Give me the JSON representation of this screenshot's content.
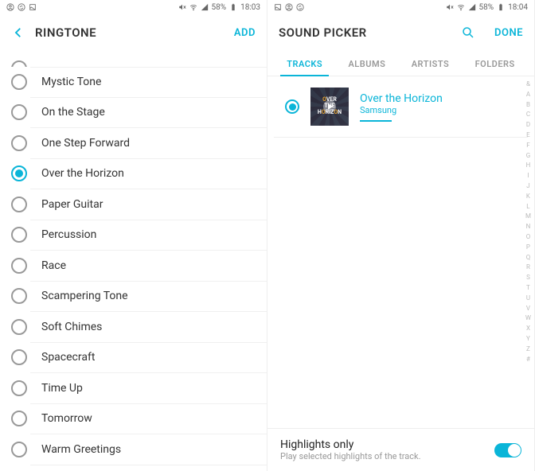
{
  "left": {
    "status": {
      "battery": "58%",
      "time": "18:03"
    },
    "title": "RINGTONE",
    "action": "ADD",
    "items": [
      {
        "label": "Mystic Tone",
        "selected": false
      },
      {
        "label": "On the Stage",
        "selected": false
      },
      {
        "label": "One Step Forward",
        "selected": false
      },
      {
        "label": "Over the Horizon",
        "selected": true
      },
      {
        "label": "Paper Guitar",
        "selected": false
      },
      {
        "label": "Percussion",
        "selected": false
      },
      {
        "label": "Race",
        "selected": false
      },
      {
        "label": "Scampering Tone",
        "selected": false
      },
      {
        "label": "Soft Chimes",
        "selected": false
      },
      {
        "label": "Spacecraft",
        "selected": false
      },
      {
        "label": "Time Up",
        "selected": false
      },
      {
        "label": "Tomorrow",
        "selected": false
      },
      {
        "label": "Warm Greetings",
        "selected": false
      }
    ]
  },
  "right": {
    "status": {
      "battery": "58%",
      "time": "18:04"
    },
    "title": "SOUND PICKER",
    "action": "DONE",
    "tabs": [
      {
        "label": "TRACKS",
        "active": true
      },
      {
        "label": "ALBUMS",
        "active": false
      },
      {
        "label": "ARTISTS",
        "active": false
      },
      {
        "label": "FOLDERS",
        "active": false
      }
    ],
    "track": {
      "name": "Over the Horizon",
      "artist": "Samsung",
      "selected": true
    },
    "index": "&ABCDEFGHIJKLMNOPQRSTUVWXYZ#",
    "highlights": {
      "title": "Highlights only",
      "sub": "Play selected highlights of the track.",
      "on": true
    }
  }
}
